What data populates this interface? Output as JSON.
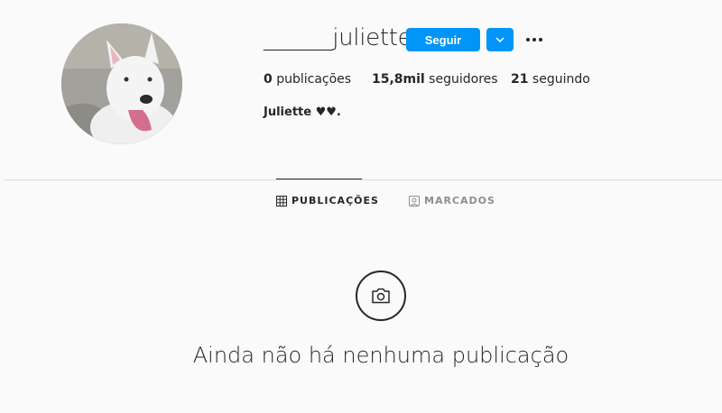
{
  "profile": {
    "username": "______juliette_",
    "follow_label": "Seguir",
    "bio": "Juliette ♥♥.",
    "avatar_icon": "dog-avatar-photo"
  },
  "stats": {
    "posts_count": "0",
    "posts_label": " publicações",
    "followers_count": "15,8mil",
    "followers_label": " seguidores",
    "following_count": "21",
    "following_label": " seguindo"
  },
  "tabs": [
    {
      "label": "PUBLICAÇÕES",
      "icon": "grid-icon",
      "active": true
    },
    {
      "label": "MARCADOS",
      "icon": "tagged-icon",
      "active": false
    }
  ],
  "empty_state": {
    "icon": "camera-icon",
    "message": "Ainda não há nenhuma publicação"
  },
  "colors": {
    "accent": "#0095f6",
    "background": "#fafafa",
    "text": "#262626",
    "muted": "#8e8e8e"
  }
}
